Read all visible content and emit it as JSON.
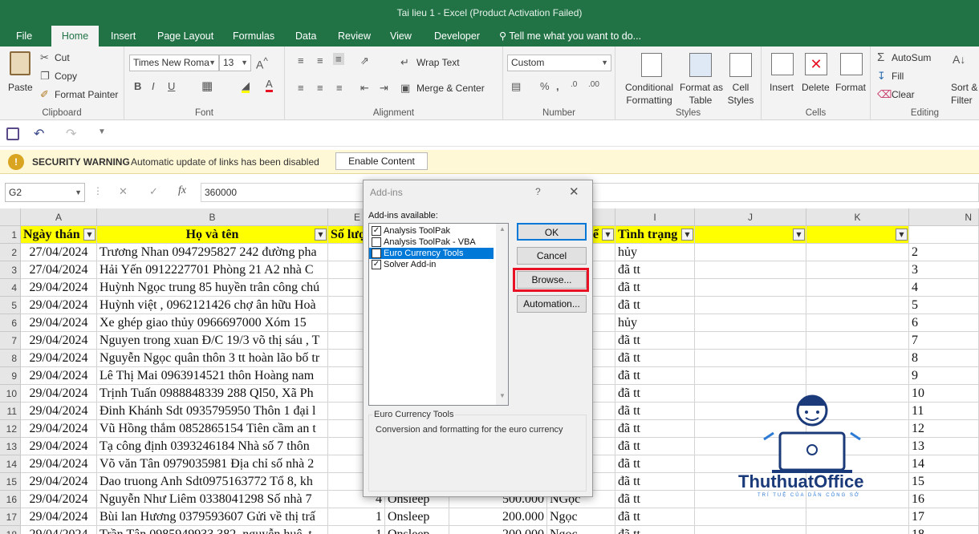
{
  "app": {
    "title": "Tai lieu 1 - Excel (Product Activation Failed)"
  },
  "tabs": [
    "File",
    "Home",
    "Insert",
    "Page Layout",
    "Formulas",
    "Data",
    "Review",
    "View",
    "Developer"
  ],
  "tellme": "Tell me what you want to do...",
  "ribbon": {
    "clipboard": {
      "label": "Clipboard",
      "paste": "Paste",
      "cut": "Cut",
      "copy": "Copy",
      "painter": "Format Painter"
    },
    "font": {
      "label": "Font",
      "name": "Times New Roma",
      "size": "13"
    },
    "alignment": {
      "label": "Alignment",
      "wrap": "Wrap Text",
      "merge": "Merge & Center"
    },
    "number": {
      "label": "Number",
      "format": "Custom"
    },
    "styles": {
      "label": "Styles",
      "cond1": "Conditional",
      "cond2": "Formatting",
      "fmt1": "Format as",
      "fmt2": "Table",
      "cell1": "Cell",
      "cell2": "Styles"
    },
    "cells": {
      "label": "Cells",
      "insert": "Insert",
      "delete": "Delete",
      "format": "Format"
    },
    "editing": {
      "label": "Editing",
      "autosum": "AutoSum",
      "fill": "Fill",
      "clear": "Clear",
      "sort1": "Sort &",
      "sort2": "Filter"
    }
  },
  "security": {
    "title": "SECURITY WARNING",
    "message": "Automatic update of links has been disabled",
    "button": "Enable Content"
  },
  "formula": {
    "namebox": "G2",
    "value": "360000"
  },
  "columns": [
    "A",
    "B",
    "E",
    "I",
    "J",
    "K",
    "N"
  ],
  "header": {
    "a": "Ngày thán",
    "b": "Họ và tên",
    "e": "Số lượ",
    "h": "iể",
    "i": "Tình trạng"
  },
  "rows": [
    {
      "n": "2",
      "a": "27/04/2024",
      "b": "Trương Nhan 0947295827 242 đường pha",
      "i": "hủy"
    },
    {
      "n": "3",
      "a": "27/04/2024",
      "b": "Hải Yến 0912227701 Phòng 21 A2 nhà C",
      "i": "đã tt"
    },
    {
      "n": "4",
      "a": "29/04/2024",
      "b": "Huỳnh Ngọc trung 85 huyền trân công chú",
      "i": "đã tt"
    },
    {
      "n": "5",
      "a": "29/04/2024",
      "b": "Huỳnh việt , 0962121426 chợ ân hữu Hoà",
      "i": "đã tt"
    },
    {
      "n": "6",
      "a": "29/04/2024",
      "b": " Xe ghép giao thủy 0966697000 Xóm 15",
      "i": "hủy"
    },
    {
      "n": "7",
      "a": "29/04/2024",
      "b": "Nguyen trong xuan Đ/C 19/3 võ thị sáu , T",
      "i": "đã tt"
    },
    {
      "n": "8",
      "a": "29/04/2024",
      "b": "Nguyễn Ngọc quân thôn 3 tt hoàn lão bố tr",
      "i": "đã tt"
    },
    {
      "n": "9",
      "a": "29/04/2024",
      "b": "Lê Thị Mai 0963914521 thôn Hoàng nam",
      "i": "đã tt"
    },
    {
      "n": "10",
      "a": "29/04/2024",
      "b": "Trịnh Tuấn 0988848339 288 Ql50, Xã Ph",
      "i": "đã tt"
    },
    {
      "n": "11",
      "a": "29/04/2024",
      "b": "Đinh Khánh Sdt 0935795950 Thôn 1 đại l",
      "i": "đã tt"
    },
    {
      "n": "12",
      "a": "29/04/2024",
      "b": "Vũ Hồng thắm 0852865154 Tiên cầm an t",
      "i": "đã tt"
    },
    {
      "n": "13",
      "a": "29/04/2024",
      "b": "Tạ công định 0393246184 Nhà số 7 thôn",
      "i": "đã tt"
    },
    {
      "n": "14",
      "a": "29/04/2024",
      "b": " Võ văn Tân 0979035981 Địa chỉ số nhà 2",
      "i": "đã tt"
    },
    {
      "n": "15",
      "a": "29/04/2024",
      "b": "Dao truong Anh  Sdt0975163772 Tổ 8, kh",
      "i": "đã tt"
    },
    {
      "n": "16",
      "a": "29/04/2024",
      "b": "Nguyễn Như Liêm 0338041298 Số nhà 7",
      "e": "4",
      "f": "Onsleep",
      "g": "500.000",
      "h": "NGọc",
      "i": "đã tt"
    },
    {
      "n": "17",
      "a": "29/04/2024",
      "b": "Bùi lan Hương 0379593607 Gửi về thị trấ",
      "e": "1",
      "f": "Onsleep",
      "g": "200.000",
      "h": "Ngọc",
      "i": "đã tt"
    },
    {
      "n": "18",
      "a": "29/04/2024",
      "b": "Trần Tân 0985949933 382, nguyễn huệ, t",
      "e": "1",
      "f": "Onsleep",
      "g": "200.000",
      "h": "Ngọc",
      "i": "đã tt"
    }
  ],
  "dialog": {
    "title": "Add-ins",
    "help": "?",
    "available": "Add-ins available:",
    "items": [
      {
        "label": "Analysis ToolPak",
        "checked": true
      },
      {
        "label": "Analysis ToolPak - VBA",
        "checked": false
      },
      {
        "label": "Euro Currency Tools",
        "checked": false
      },
      {
        "label": "Solver Add-in",
        "checked": true
      }
    ],
    "ok": "OK",
    "cancel": "Cancel",
    "browse": "Browse...",
    "automation": "Automation...",
    "desc_title": "Euro Currency Tools",
    "desc": "Conversion and formatting for the euro currency"
  },
  "watermark": {
    "brand": "ThuthuatOffice",
    "tagline": "TRÍ TUỆ CỦA DÂN CÔNG SỞ"
  },
  "colors": {
    "excel_green": "#217346",
    "header_yellow": "#ffff00",
    "selected_blue": "#0078d7",
    "highlight_red": "#e81123"
  }
}
